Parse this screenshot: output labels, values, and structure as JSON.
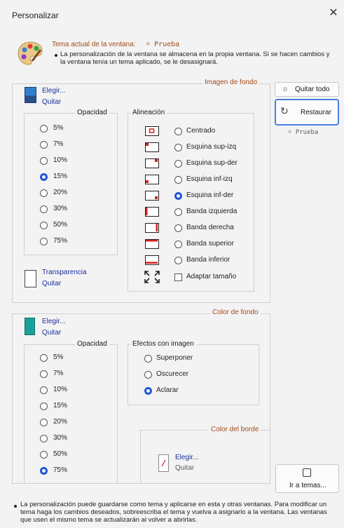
{
  "window": {
    "title": "Personalizar",
    "close_icon": "✕"
  },
  "header": {
    "theme_label": "Tema actual de la ventana:",
    "theme_name": "☼ Prueba",
    "note": "La personalización de la ventana se almacena en la propia ventana. Si se hacen cambios y la ventana tenía un tema aplicado, se le desasignará."
  },
  "background_image": {
    "group_label": "Imagen de fondo",
    "choose": "Elegir...",
    "remove": "Quitar",
    "opacity_label": "Opacidad",
    "opacity_options": [
      "5%",
      "7%",
      "10%",
      "15%",
      "20%",
      "30%",
      "50%",
      "75%"
    ],
    "opacity_selected": "15%",
    "alignment_label": "Alineación",
    "alignment_options": [
      "Centrado",
      "Esquina sup-izq",
      "Esquina sup-der",
      "Esquina inf-izq",
      "Esquina inf-der",
      "Banda izquierda",
      "Banda derecha",
      "Banda superior",
      "Banda inferior"
    ],
    "alignment_selected": "Esquina inf-der",
    "fit_label": "Adaptar tamaño",
    "fit_checked": false,
    "transparency": "Transparencia",
    "transparency_remove": "Quitar"
  },
  "side_buttons": {
    "clear_all": "Quitar todo",
    "restore": "Restaurar",
    "theme_name": "☼ Prueba"
  },
  "background_color": {
    "group_label": "Color de fondo",
    "choose": "Elegir...",
    "remove": "Quitar",
    "swatch_color": "#1aa09a",
    "opacity_label": "Opacidad",
    "opacity_options": [
      "5%",
      "7%",
      "10%",
      "15%",
      "20%",
      "30%",
      "50%",
      "75%"
    ],
    "opacity_selected": "75%",
    "effects_label": "Efectos con imagen",
    "effects_options": [
      "Superponer",
      "Oscurecer",
      "Aclarar"
    ],
    "effects_selected": "Aclarar"
  },
  "border_color": {
    "group_label": "Color del borde",
    "choose": "Elegir...",
    "remove": "Quitar"
  },
  "go_to_themes": "Ir a temas...",
  "footer_note": "La personalización puede guardarse como tema y aplicarse en esta y otras ventanas. Para modificar un tema haga los cambios deseados, sobreescriba el tema y vuelva a asignarlo a la ventana. Las ventanas que usen el mismo tema se actualizarán al volver a abrirlas.",
  "accent_color": "#1e55d3",
  "selection_color": "#d42020"
}
